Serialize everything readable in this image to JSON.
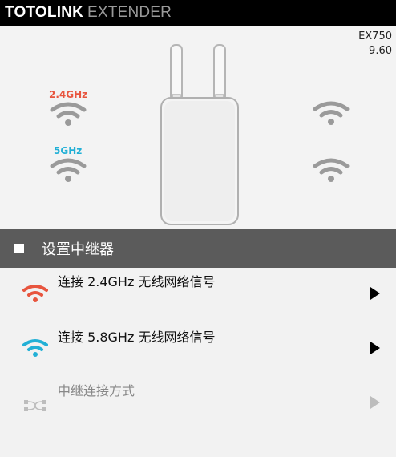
{
  "header": {
    "brand": "TOTOLINK",
    "product": "EXTENDER"
  },
  "device": {
    "model": "EX750",
    "version": "9.60",
    "band_24_label": "2.4GHz",
    "band_5_label": "5GHz"
  },
  "colors": {
    "band_24": "#e8553e",
    "band_5": "#22b0d6",
    "inactive": "#c0c0c0"
  },
  "section": {
    "title": "设置中继器"
  },
  "menu": [
    {
      "label": "连接 2.4GHz 无线网络信号",
      "icon": "wifi-orange-icon",
      "enabled": true
    },
    {
      "label": "连接 5.8GHz 无线网络信号",
      "icon": "wifi-blue-icon",
      "enabled": true
    },
    {
      "label": "中继连接方式",
      "icon": "shuffle-icon",
      "enabled": false
    }
  ]
}
